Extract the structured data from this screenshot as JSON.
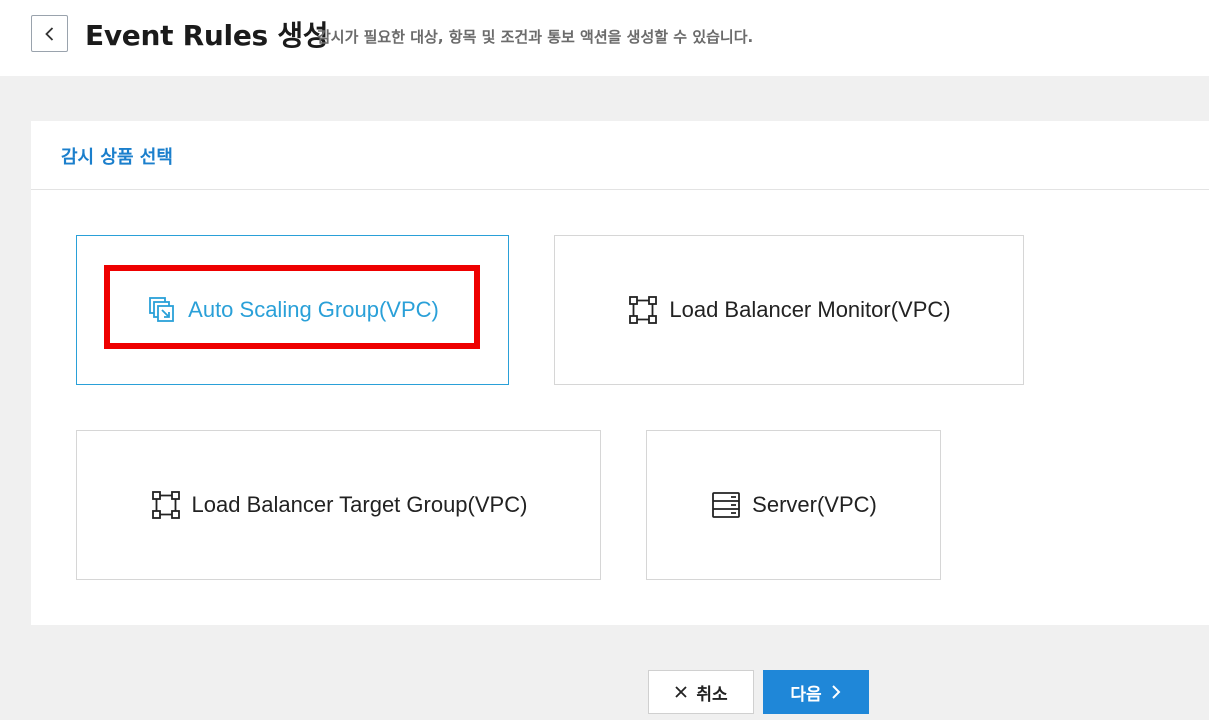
{
  "header": {
    "title": "Event Rules 생성",
    "description": "감시가 필요한 대상, 항목 및 조건과 통보 액션을 생성할 수 있습니다."
  },
  "panel": {
    "title": "감시 상품 선택"
  },
  "products": [
    {
      "label": "Auto Scaling Group(VPC)",
      "icon": "auto-scaling-icon",
      "selected": true
    },
    {
      "label": "Load Balancer Monitor(VPC)",
      "icon": "load-balancer-icon",
      "selected": false
    },
    {
      "label": "Load Balancer Target Group(VPC)",
      "icon": "load-balancer-icon",
      "selected": false
    },
    {
      "label": "Server(VPC)",
      "icon": "server-icon",
      "selected": false
    }
  ],
  "actions": {
    "cancel_label": "취소",
    "next_label": "다음"
  },
  "colors": {
    "accent": "#1f87d8",
    "selected": "#2aa0d8",
    "highlight": "#ee0000"
  }
}
